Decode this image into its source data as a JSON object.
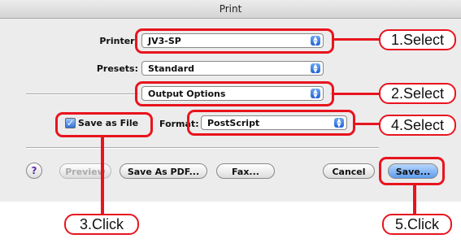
{
  "window": {
    "title": "Print"
  },
  "form": {
    "printer_label": "Printer:",
    "printer_value": "JV3-SP",
    "presets_label": "Presets:",
    "presets_value": "Standard",
    "section_value": "Output Options",
    "save_as_file_label": "Save as File",
    "save_as_file_checked": true,
    "format_label": "Format:",
    "format_value": "PostScript"
  },
  "buttons": {
    "help": "?",
    "preview": "Preview",
    "save_as_pdf": "Save As PDF...",
    "fax": "Fax...",
    "cancel": "Cancel",
    "save": "Save..."
  },
  "callouts": {
    "step1": "1.Select",
    "step2": "2.Select",
    "step3": "3.Click",
    "step4": "4.Select",
    "step5": "5.Click"
  },
  "colors": {
    "annotation": "#e8141e",
    "default_button": "#5d9cf0"
  }
}
